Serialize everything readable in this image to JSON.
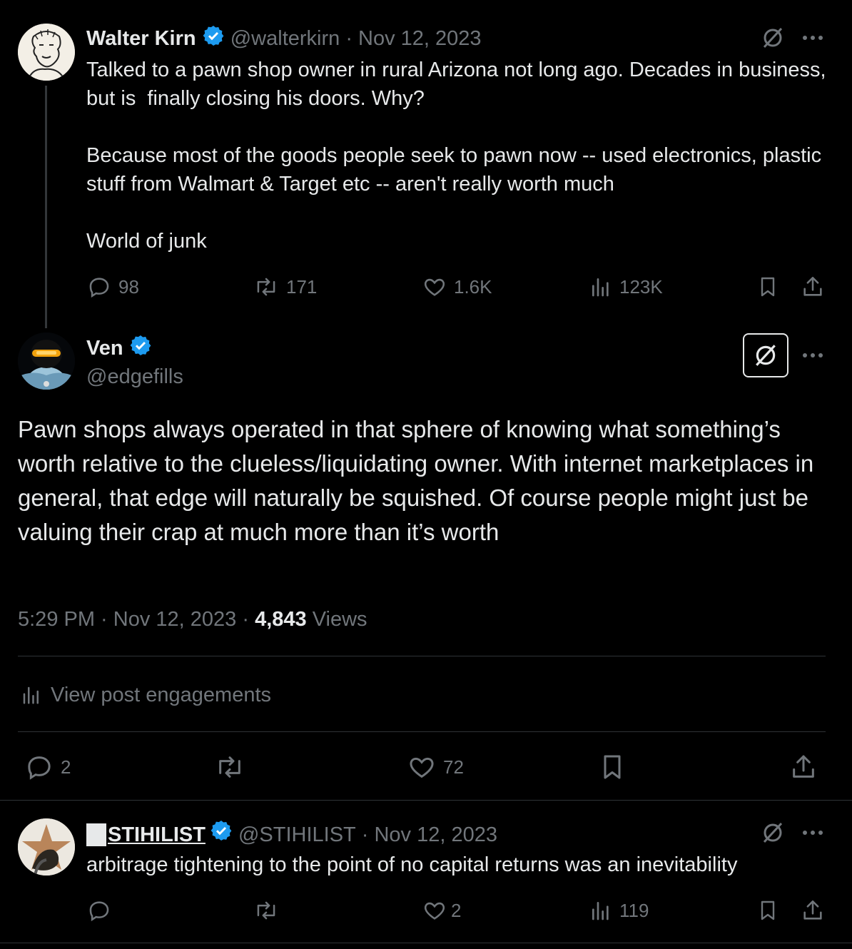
{
  "colors": {
    "background": "#000000",
    "text": "#e7e9ea",
    "muted": "#71767b",
    "verified": "#1d9bf0",
    "divider": "#2f3336"
  },
  "tweet1": {
    "name": "Walter Kirn",
    "handle": "@walterkirn",
    "date": "· Nov 12, 2023",
    "text": "Talked to a pawn shop owner in rural Arizona not long ago. Decades in business, but is  finally closing his doors. Why?\n\nBecause most of the goods people seek to pawn now -- used electronics, plastic stuff from Walmart & Target etc -- aren't really worth much\n\nWorld of junk",
    "replies": "98",
    "reposts": "171",
    "likes": "1.6K",
    "views": "123K"
  },
  "main": {
    "name": "Ven",
    "handle": "@edgefills",
    "text": "Pawn shops always operated in that sphere of knowing what something’s worth relative to the clueless/liquidating owner. With internet marketplaces in general, that edge will naturally be squished. Of course people might just be valuing their crap at much more than it’s worth",
    "time": "5:29 PM · Nov 12, 2023 · ",
    "views_count": "4,843",
    "views_label": " Views",
    "engagements": "View post engagements",
    "replies": "2",
    "likes": "72"
  },
  "reply": {
    "name": "STIHILIST",
    "handle": "@STIHILIST",
    "date": "· Nov 12, 2023",
    "text": "arbitrage tightening to the point of no capital returns was an inevitability",
    "likes": "2",
    "views": "119"
  }
}
